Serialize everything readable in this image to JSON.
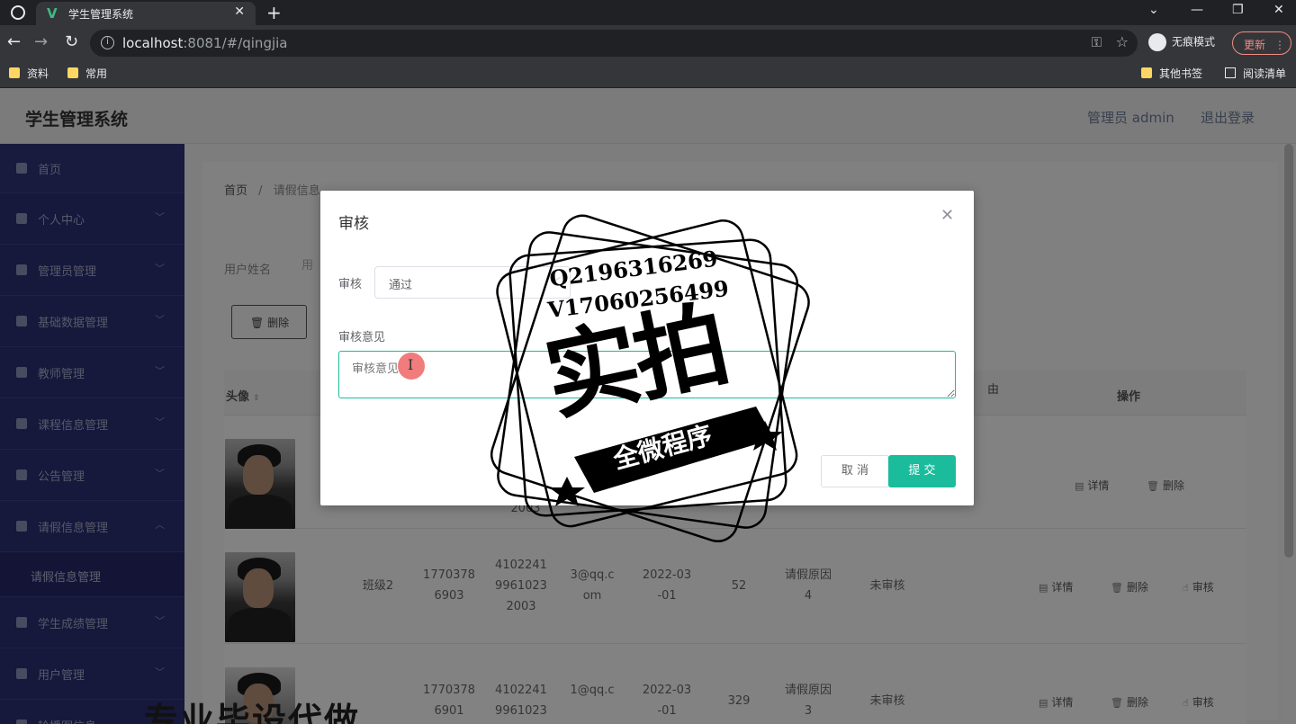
{
  "browser": {
    "tab_title": "学生管理系统",
    "url_host": "localhost",
    "url_rest": ":8081/#/qingjia",
    "incognito_label": "无痕模式",
    "update_label": "更新",
    "bookmarks": [
      "资料",
      "常用"
    ],
    "bookmarks_right": [
      "其他书签",
      "阅读清单"
    ]
  },
  "header": {
    "title": "学生管理系统",
    "admin": "管理员 admin",
    "logout": "退出登录"
  },
  "sidebar": {
    "items": [
      {
        "label": "首页"
      },
      {
        "label": "个人中心"
      },
      {
        "label": "管理员管理"
      },
      {
        "label": "基础数据管理"
      },
      {
        "label": "教师管理"
      },
      {
        "label": "课程信息管理"
      },
      {
        "label": "公告管理"
      },
      {
        "label": "请假信息管理"
      },
      {
        "label": "学生成绩管理"
      },
      {
        "label": "用户管理"
      },
      {
        "label": "轮播图信息"
      }
    ],
    "sub_item": "请假信息管理"
  },
  "main": {
    "breadcrumb_home": "首页",
    "breadcrumb_sep": "/",
    "breadcrumb_current": "请假信息",
    "filter_label": "用户姓名",
    "filter_placeholder": "用",
    "delete_button": "删除",
    "table": {
      "headers": {
        "avatar": "头像",
        "reason_partial": "由",
        "actions": "操作"
      },
      "rows": [
        {
          "class": "",
          "phone": "",
          "id_card": "2003",
          "email": "",
          "date": "",
          "days": "",
          "reason": "",
          "status": ""
        },
        {
          "class": "班级2",
          "phone": "17703786903",
          "id_card": "410224119961023 2003",
          "email": "3@qq.com",
          "date": "2022-03-01",
          "days": "52",
          "reason": "请假原因4",
          "status": "未审核"
        },
        {
          "class": "",
          "phone": "17703786901",
          "id_card": "41022411996102 3",
          "email": "1@qq.c",
          "date": "2022-03-01",
          "days": "329",
          "reason": "请假原因3",
          "status": "未审核"
        }
      ],
      "row1_phone": [
        "1770378",
        "6903"
      ],
      "row1_id": [
        "4102241",
        "9961023",
        "2003"
      ],
      "row1_email": [
        "3@qq.c",
        "om"
      ],
      "row1_date": [
        "2022-03",
        "-01"
      ],
      "row1_reason": [
        "请假原因",
        "4"
      ],
      "row2_phone": [
        "1770378",
        "6901"
      ],
      "row2_id": [
        "4102241",
        "9961023"
      ],
      "row2_email": [
        "1@qq.c"
      ],
      "row2_date": [
        "2022-03",
        "-01"
      ],
      "row2_reason": [
        "请假原因",
        "3"
      ],
      "action_details": "详情",
      "action_delete": "删除",
      "action_review": "审核"
    }
  },
  "dialog": {
    "title": "审核",
    "field1_label": "审核",
    "field1_value": "通过",
    "field2_label": "审核意见",
    "field2_placeholder": "审核意见",
    "cancel": "取 消",
    "submit": "提 交"
  },
  "watermark": {
    "line1": "Q2196316269",
    "line2": "V17060256499",
    "big": "实拍",
    "banner": "全微程序",
    "bottom": "专业毕设代做"
  }
}
